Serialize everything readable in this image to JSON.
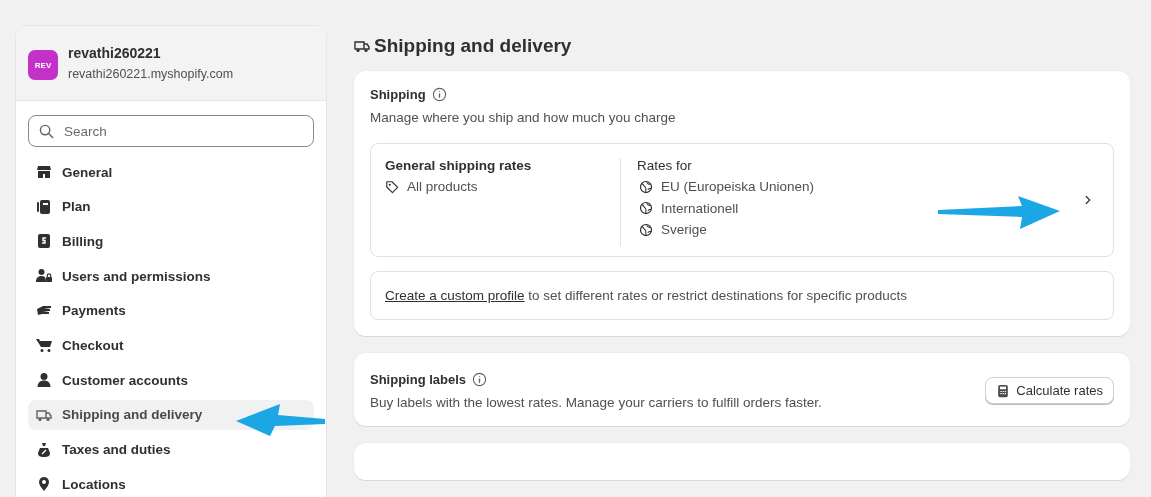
{
  "store": {
    "avatar": "REV",
    "name": "revathi260221",
    "domain": "revathi260221.myshopify.com"
  },
  "search": {
    "placeholder": "Search"
  },
  "sidebar": {
    "items": [
      {
        "label": "General",
        "selected": false
      },
      {
        "label": "Plan",
        "selected": false
      },
      {
        "label": "Billing",
        "selected": false
      },
      {
        "label": "Users and permissions",
        "selected": false
      },
      {
        "label": "Payments",
        "selected": false
      },
      {
        "label": "Checkout",
        "selected": false
      },
      {
        "label": "Customer accounts",
        "selected": false
      },
      {
        "label": "Shipping and delivery",
        "selected": true
      },
      {
        "label": "Taxes and duties",
        "selected": false
      },
      {
        "label": "Locations",
        "selected": false
      }
    ]
  },
  "page": {
    "title": "Shipping and delivery"
  },
  "shipping": {
    "title": "Shipping",
    "description": "Manage where you ship and how much you charge",
    "general_rates": {
      "title": "General shipping rates",
      "products": "All products"
    },
    "rates_for": {
      "title": "Rates for",
      "zones": [
        "EU (Europeiska Unionen)",
        "Internationell",
        "Sverige"
      ]
    },
    "custom_profile": {
      "link": "Create a custom profile",
      "text": " to set different rates or restrict destinations for specific products"
    }
  },
  "shipping_labels": {
    "title": "Shipping labels",
    "description": "Buy labels with the lowest rates. Manage your carriers to fulfill orders faster.",
    "button": "Calculate rates"
  }
}
